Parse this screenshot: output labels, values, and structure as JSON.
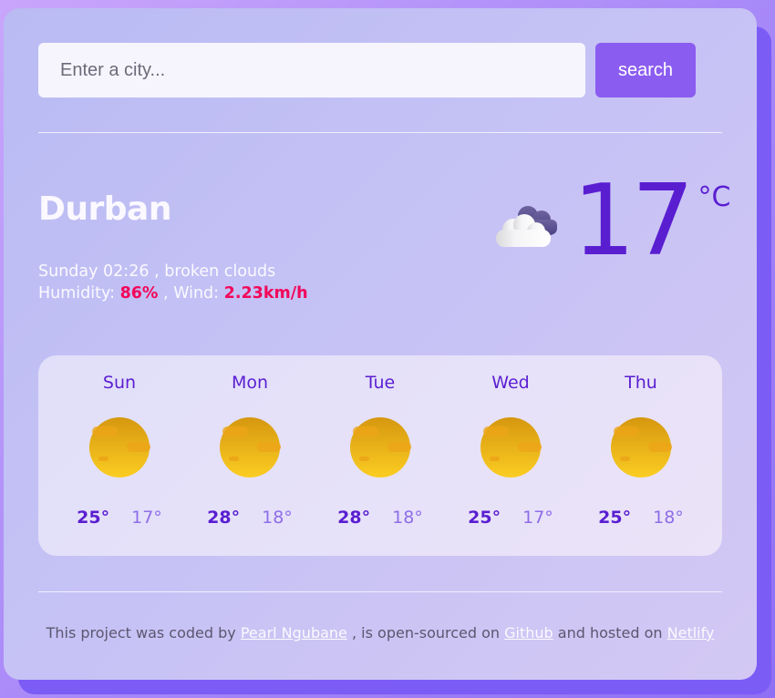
{
  "search": {
    "placeholder": "Enter a city...",
    "value": "",
    "button_label": "search"
  },
  "current": {
    "city": "Durban",
    "day_time": "Sunday 02:26",
    "description": "broken clouds",
    "humidity_label": "Humidity:",
    "humidity": "86%",
    "wind_label": "Wind:",
    "wind": "2.23km/h",
    "separator": ",",
    "icon": "broken-clouds-icon",
    "temperature": "17",
    "unit": "°C"
  },
  "forecast": [
    {
      "day": "Sun",
      "icon": "sun-icon",
      "max": "25°",
      "min": "17°"
    },
    {
      "day": "Mon",
      "icon": "sun-icon",
      "max": "28°",
      "min": "18°"
    },
    {
      "day": "Tue",
      "icon": "sun-icon",
      "max": "28°",
      "min": "18°"
    },
    {
      "day": "Wed",
      "icon": "sun-icon",
      "max": "25°",
      "min": "17°"
    },
    {
      "day": "Thu",
      "icon": "sun-icon",
      "max": "25°",
      "min": "18°"
    }
  ],
  "footer": {
    "text_1": "This project was coded by",
    "author_link": "Pearl Ngubane",
    "text_2": ", is open-sourced on",
    "github_link": "Github",
    "text_3": "and hosted on",
    "netlify_link": "Netlify"
  },
  "colors": {
    "accent": "#5a1ed1",
    "button": "#8b5cf0",
    "highlight": "#f2075a",
    "shadow": "#7b5cf5"
  }
}
